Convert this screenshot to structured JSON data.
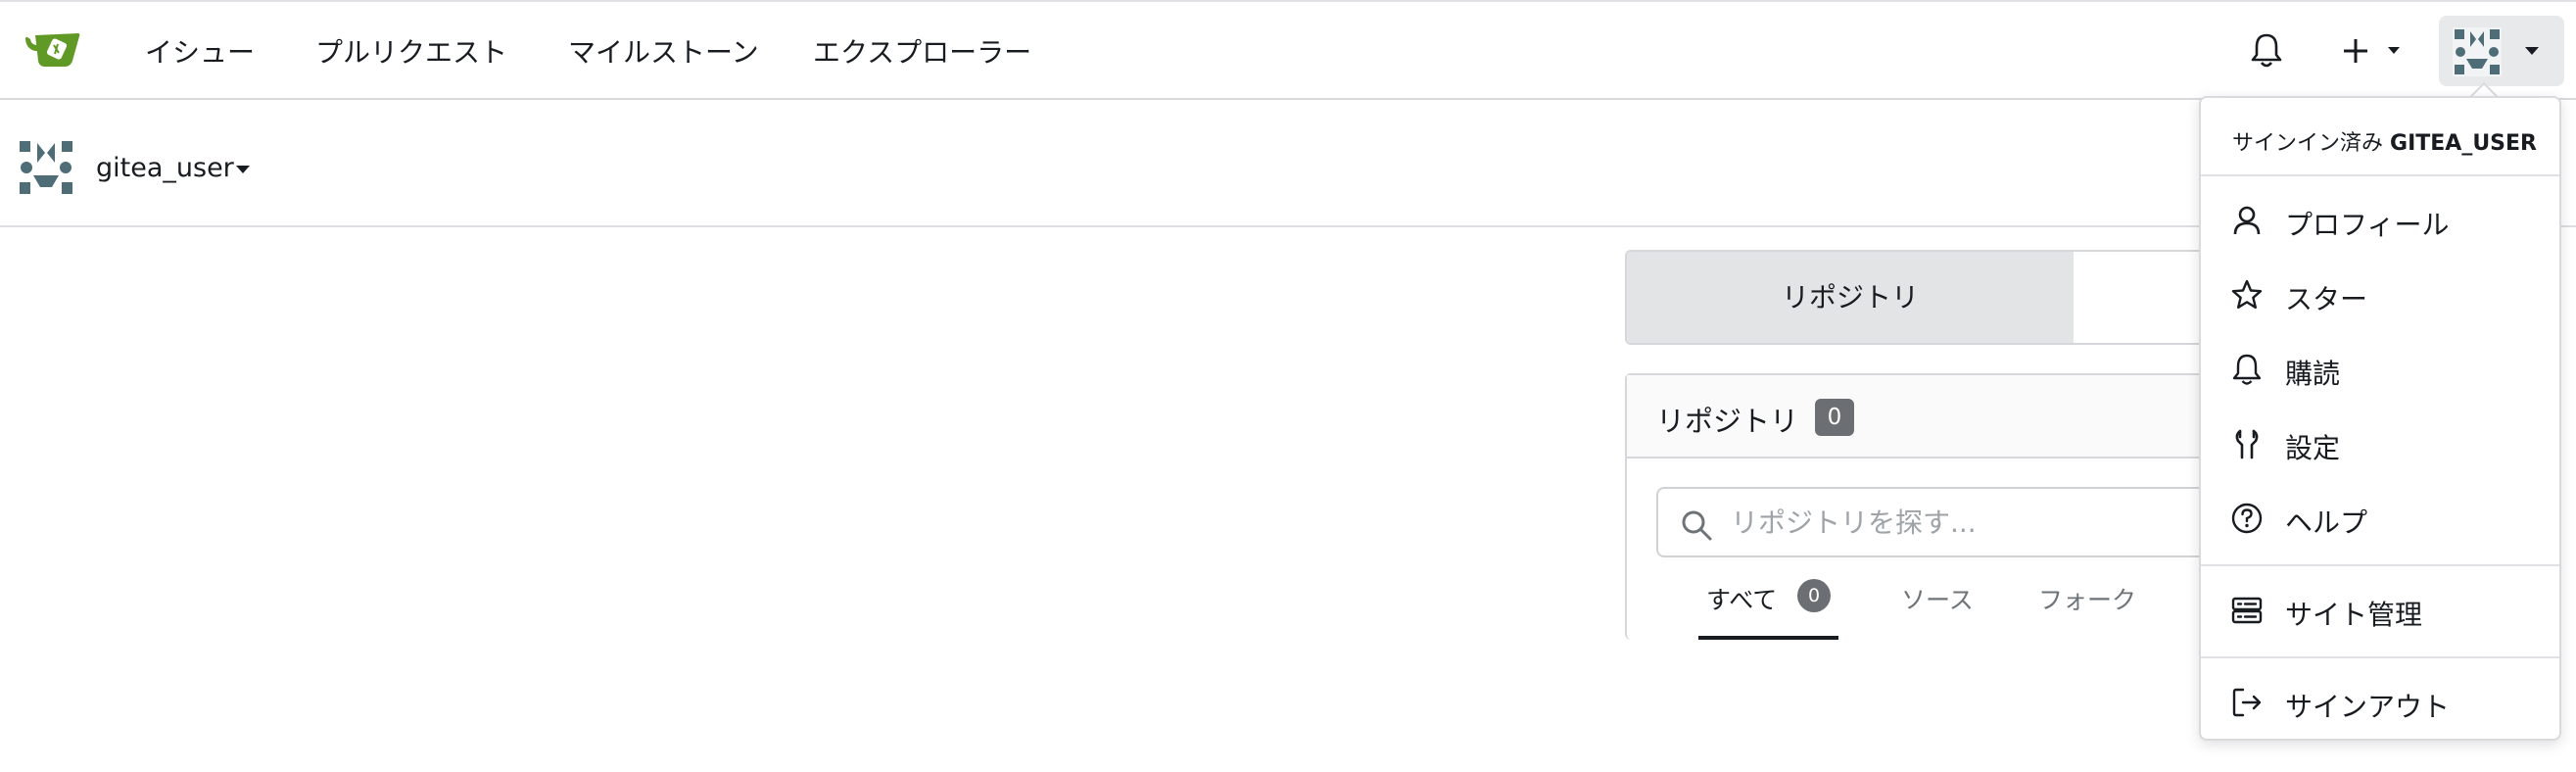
{
  "navbar": {
    "items": [
      {
        "label": "イシュー"
      },
      {
        "label": "プルリクエスト"
      },
      {
        "label": "マイルストーン"
      },
      {
        "label": "エクスプローラー"
      }
    ]
  },
  "context": {
    "username": "gitea_user"
  },
  "tabs": {
    "active_label": "リポジトリ"
  },
  "repo_panel": {
    "title": "リポジトリ",
    "count": "0",
    "search_placeholder": "リポジトリを探す...",
    "filters": [
      {
        "label": "すべて",
        "count": "0"
      },
      {
        "label": "ソース"
      },
      {
        "label": "フォーク"
      }
    ]
  },
  "user_menu": {
    "signed_in_prefix": "サインイン済み",
    "signed_in_user": "GITEA_USER",
    "items": [
      {
        "label": "プロフィール",
        "icon": "person-icon"
      },
      {
        "label": "スター",
        "icon": "star-icon"
      },
      {
        "label": "購読",
        "icon": "bell-icon"
      },
      {
        "label": "設定",
        "icon": "tools-icon"
      },
      {
        "label": "ヘルプ",
        "icon": "question-icon"
      },
      {
        "label": "サイト管理",
        "icon": "server-icon"
      },
      {
        "label": "サインアウト",
        "icon": "sign-out-icon"
      }
    ]
  },
  "colors": {
    "brand": "#609926",
    "avatar": "#4f6d77",
    "badge": "#6b6f74"
  }
}
